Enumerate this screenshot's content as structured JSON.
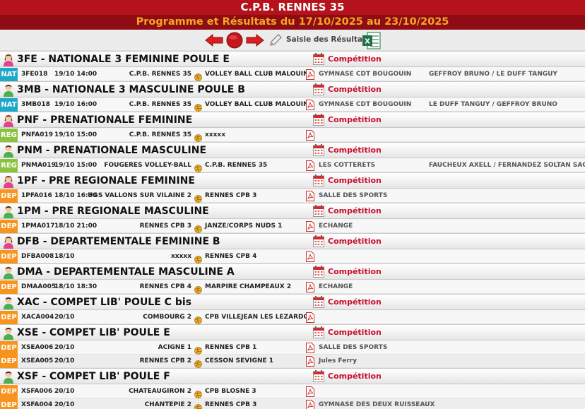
{
  "header": {
    "club": "C.P.B. RENNES 35",
    "subtitle": "Programme et Résultats du 17/10/2025 au 23/10/2025"
  },
  "toolbar": {
    "prev_icon": "arrow-left-icon",
    "stop_icon": "stop-icon",
    "next_icon": "arrow-right-icon",
    "entry_icon": "pencil-icon",
    "entry_label": "Saisie des Résultats",
    "excel_icon": "excel-icon"
  },
  "colors": {
    "NAT": "#1ea7c9",
    "REG": "#8ac43f",
    "DEP": "#f7941d",
    "header": "#b5121b",
    "accent": "#f5a623"
  },
  "competition_label": "Compétition",
  "sections": [
    {
      "gender": "female",
      "title": "3FE - NATIONALE 3 FEMININE POULE E",
      "matches": [
        {
          "level": "NAT",
          "code": "3FE018",
          "date": "19/10 14:00",
          "home": "C.P.B. RENNES 35",
          "away": "VOLLEY BALL CLUB MALOUIN",
          "venue": "GYMNASE CDT BOUGOUIN",
          "referees": "GEFFROY BRUNO / LE DUFF TANGUY"
        }
      ]
    },
    {
      "gender": "male",
      "title": "3MB - NATIONALE 3 MASCULINE POULE B",
      "matches": [
        {
          "level": "NAT",
          "code": "3MB018",
          "date": "19/10 16:00",
          "home": "C.P.B. RENNES 35",
          "away": "VOLLEY BALL CLUB MALOUIN",
          "venue": "GYMNASE CDT BOUGOUIN",
          "referees": "LE DUFF TANGUY / GEFFROY BRUNO"
        }
      ]
    },
    {
      "gender": "female",
      "title": "PNF - PRENATIONALE FEMININE",
      "matches": [
        {
          "level": "REG",
          "code": "PNFA019",
          "date": "19/10 15:00",
          "home": "C.P.B. RENNES 35",
          "away": "xxxxx",
          "venue": "",
          "referees": ""
        }
      ]
    },
    {
      "gender": "male",
      "title": "PNM - PRENATIONALE MASCULINE",
      "matches": [
        {
          "level": "REG",
          "code": "PNMA019",
          "date": "19/10 15:00",
          "home": "FOUGERES VOLLEY-BALL",
          "away": "C.P.B. RENNES 35",
          "venue": "LES COTTERETS",
          "referees": "FAUCHEUX AXELL / FERNANDEZ SOLTAN SACHA"
        }
      ]
    },
    {
      "gender": "female",
      "title": "1PF - PRE REGIONALE FEMININE",
      "matches": [
        {
          "level": "DEP",
          "code": "1PFA016",
          "date": "18/10 16:30",
          "home": "UGS VALLONS SUR VILAINE 2",
          "away": "RENNES CPB 3",
          "venue": "SALLE DES SPORTS",
          "referees": ""
        }
      ]
    },
    {
      "gender": "male",
      "title": "1PM - PRE REGIONALE MASCULINE",
      "matches": [
        {
          "level": "DEP",
          "code": "1PMA017",
          "date": "18/10 21:00",
          "home": "RENNES CPB 3",
          "away": "JANZE/CORPS NUDS 1",
          "venue": "ECHANGE",
          "referees": ""
        }
      ]
    },
    {
      "gender": "female",
      "title": "DFB - DEPARTEMENTALE FEMININE B",
      "matches": [
        {
          "level": "DEP",
          "code": "DFBA008",
          "date": "18/10",
          "home": "xxxxx",
          "away": "RENNES CPB 4",
          "venue": "",
          "referees": ""
        }
      ]
    },
    {
      "gender": "male",
      "title": "DMA - DEPARTEMENTALE MASCULINE A",
      "matches": [
        {
          "level": "DEP",
          "code": "DMAA005",
          "date": "18/10 18:30",
          "home": "RENNES CPB 4",
          "away": "MARPIRE CHAMPEAUX 2",
          "venue": "ECHANGE",
          "referees": ""
        }
      ]
    },
    {
      "gender": "male",
      "title": "XAC - COMPET LIB' POULE C bis",
      "matches": [
        {
          "level": "DEP",
          "code": "XACA004",
          "date": "20/10",
          "home": "COMBOURG 2",
          "away": "CPB VILLEJEAN LES LEZARDOS",
          "venue": "",
          "referees": ""
        }
      ]
    },
    {
      "gender": "male",
      "title": "XSE - COMPET LIB' POULE E",
      "matches": [
        {
          "level": "DEP",
          "code": "XSEA006",
          "date": "20/10",
          "home": "ACIGNE 1",
          "away": "RENNES CPB 1",
          "venue": "SALLE DES SPORTS",
          "referees": ""
        },
        {
          "level": "DEP",
          "code": "XSEA005",
          "date": "20/10",
          "home": "RENNES CPB 2",
          "away": "CESSON SEVIGNE 1",
          "venue": "Jules Ferry",
          "referees": ""
        }
      ]
    },
    {
      "gender": "male",
      "title": "XSF - COMPET LIB' POULE F",
      "matches": [
        {
          "level": "DEP",
          "code": "XSFA006",
          "date": "20/10",
          "home": "CHATEAUGIRON 2",
          "away": "CPB BLOSNE 3",
          "venue": "",
          "referees": ""
        },
        {
          "level": "DEP",
          "code": "XSFA004",
          "date": "20/10",
          "home": "CHANTEPIE 2",
          "away": "RENNES CPB 3",
          "venue": "GYMNASE DES DEUX RUISSEAUX",
          "referees": ""
        }
      ]
    }
  ]
}
